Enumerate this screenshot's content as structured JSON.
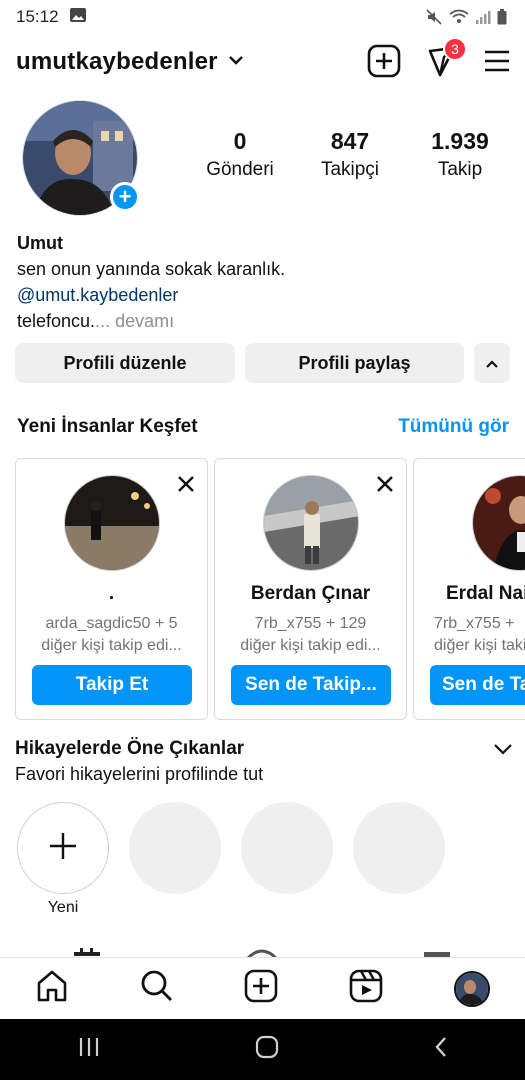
{
  "status": {
    "time": "15:12"
  },
  "header": {
    "username": "umutkaybedenler",
    "notification_count": "3"
  },
  "profile": {
    "posts_count": "0",
    "posts_label": "Gönderi",
    "followers_count": "847",
    "followers_label": "Takipçi",
    "following_count": "1.939",
    "following_label": "Takip",
    "name": "Umut",
    "bio_line": "sen onun yanında sokak karanlık.",
    "bio_link": "@umut.kaybedenler",
    "bio_text": "telefoncu.",
    "bio_more": "... devamı"
  },
  "actions": {
    "edit_profile": "Profili düzenle",
    "share_profile": "Profili paylaş"
  },
  "discover": {
    "title": "Yeni İnsanlar Keşfet",
    "see_all": "Tümünü gör",
    "cards": [
      {
        "name": ".",
        "line1": "arda_sagdic50 + 5",
        "line2": "diğer kişi takip edi...",
        "button": "Takip Et"
      },
      {
        "name": "Berdan Çınar",
        "line1": "7rb_x755 + 129",
        "line2": "diğer kişi takip edi...",
        "button": "Sen de Takip..."
      },
      {
        "name": "Erdal Nai",
        "line1": "7rb_x755 +",
        "line2": "diğer kişi takip",
        "button": "Sen de Ta"
      }
    ]
  },
  "highlights": {
    "title": "Hikayelerde Öne Çıkanlar",
    "subtitle": "Favori hikayelerini profilinde tut",
    "new_label": "Yeni"
  },
  "colors": {
    "accent": "#0095f6",
    "badge": "#ff3040",
    "link": "#00376b"
  }
}
